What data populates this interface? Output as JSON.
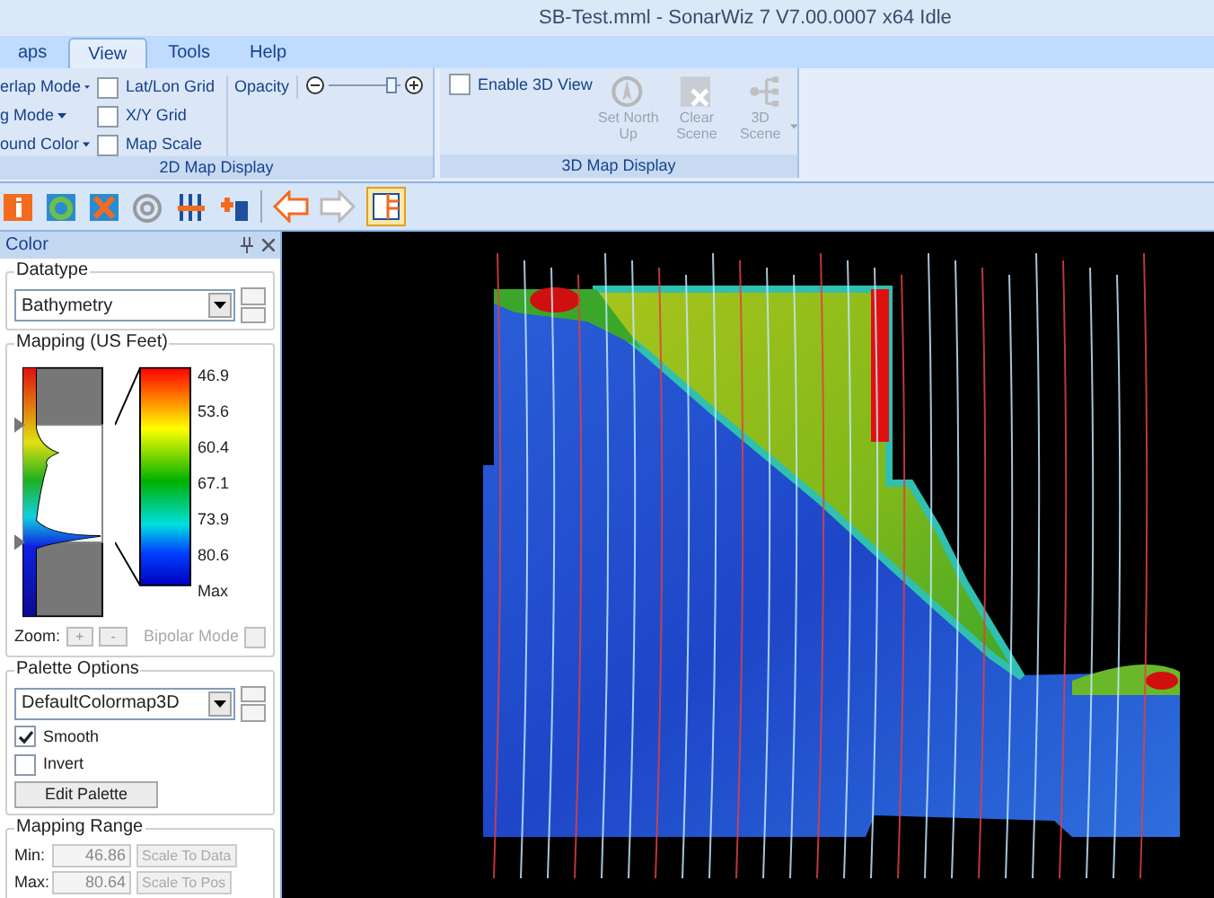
{
  "window": {
    "title": "SB-Test.mml - SonarWiz 7 V7.00.0007 x64  Idle"
  },
  "tabs": [
    {
      "label": "aps",
      "selected": false
    },
    {
      "label": "View",
      "selected": true
    },
    {
      "label": "Tools",
      "selected": false
    },
    {
      "label": "Help",
      "selected": false
    }
  ],
  "ribbon": {
    "group_2d": {
      "label": "2D Map Display",
      "menus": [
        "erlap Mode",
        "g Mode",
        "ound Color"
      ],
      "checkboxes": [
        {
          "label": "Lat/Lon Grid",
          "checked": false
        },
        {
          "label": "X/Y Grid",
          "checked": false
        },
        {
          "label": "Map Scale",
          "checked": false
        }
      ],
      "opacity": {
        "label": "Opacity",
        "level": 0.88
      }
    },
    "group_3d": {
      "label": "3D Map Display",
      "checkbox": {
        "label": "Enable 3D View",
        "checked": false
      },
      "buttons": [
        {
          "label": "Set North Up",
          "kind": "compass",
          "disabled": true,
          "dropdown": false
        },
        {
          "label": "Clear Scene",
          "kind": "clear",
          "disabled": true,
          "dropdown": false
        },
        {
          "label": "3D Scene",
          "kind": "scene",
          "disabled": true,
          "dropdown": true
        }
      ]
    }
  },
  "panel": {
    "title": "Color",
    "datatype": {
      "label": "Datatype",
      "value": "Bathymetry"
    },
    "mapping": {
      "label": "Mapping (US Feet)",
      "scale_labels": [
        "46.9",
        "53.6",
        "60.4",
        "67.1",
        "73.9",
        "80.6",
        "Max"
      ],
      "zoom_label": "Zoom:",
      "zoom_buttons": [
        "+",
        "-"
      ],
      "bipolar": {
        "label": "Bipolar Mode",
        "checked": false,
        "disabled": true
      }
    },
    "palette": {
      "label": "Palette Options",
      "value": "DefaultColormap3D",
      "options": [
        {
          "label": "Smooth",
          "checked": true
        },
        {
          "label": "Invert",
          "checked": false
        }
      ],
      "button": "Edit Palette"
    },
    "range": {
      "label": "Mapping Range",
      "rows": [
        {
          "label": "Min:",
          "value": "46.86",
          "button": "Scale To Data",
          "disabled": true
        },
        {
          "label": "Max:",
          "value": "80.64",
          "button": "Scale To Pos",
          "disabled": true
        }
      ]
    }
  }
}
